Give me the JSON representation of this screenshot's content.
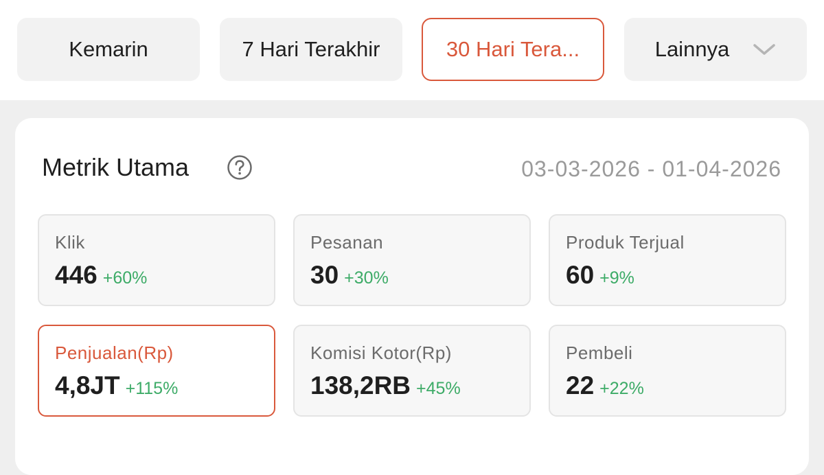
{
  "filters": {
    "yesterday": "Kemarin",
    "last7": "7 Hari Terakhir",
    "last30": "30 Hari Tera...",
    "more": "Lainnya"
  },
  "metrics_card": {
    "title": "Metrik Utama",
    "date_range": "03-03-2026 - 01-04-2026"
  },
  "metrics": [
    {
      "label": "Klik",
      "value": "446",
      "change": "+60%"
    },
    {
      "label": "Pesanan",
      "value": "30",
      "change": "+30%"
    },
    {
      "label": "Produk Terjual",
      "value": "60",
      "change": "+9%"
    },
    {
      "label": "Penjualan(Rp)",
      "value": "4,8JT",
      "change": "+115%"
    },
    {
      "label": "Komisi Kotor(Rp)",
      "value": "138,2RB",
      "change": "+45%"
    },
    {
      "label": "Pembeli",
      "value": "22",
      "change": "+22%"
    }
  ],
  "colors": {
    "accent": "#d9583b",
    "positive": "#3dab67",
    "muted": "#9a9a9a"
  },
  "icons": {
    "help": "question-circle-icon",
    "dropdown": "chevron-down-icon"
  }
}
